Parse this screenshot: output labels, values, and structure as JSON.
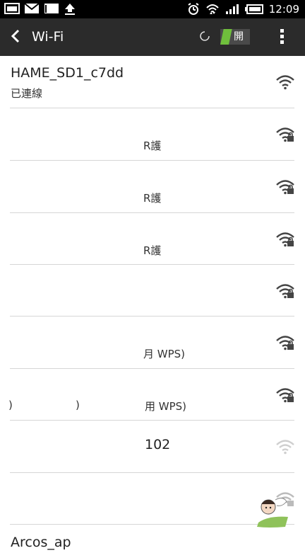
{
  "status_bar": {
    "time": "12:09",
    "icons": [
      "gallery-icon",
      "mail-icon",
      "gmail-icon",
      "upload-icon",
      "alarm-icon",
      "wifi-status-icon",
      "signal-icon",
      "battery-icon"
    ]
  },
  "action_bar": {
    "title": "Wi-Fi",
    "toggle_label": "開"
  },
  "networks": [
    {
      "ssid": "HAME_SD1_c7dd",
      "subtitle": "已連線",
      "secured": false
    },
    {
      "ssid": "",
      "subtitle": "R護",
      "secured": true
    },
    {
      "ssid": "",
      "subtitle": "R護",
      "secured": true
    },
    {
      "ssid": "",
      "subtitle": "R護",
      "secured": true
    },
    {
      "ssid": "",
      "subtitle": "",
      "secured": true
    },
    {
      "ssid": "",
      "subtitle": "月 WPS)",
      "secured": true
    },
    {
      "ssid": "",
      "subtitle": "用 WPS)",
      "secured": true,
      "fragments": [
        ")",
        ")"
      ]
    },
    {
      "ssid": "",
      "subtitle": "102",
      "secured": false,
      "weak": true
    },
    {
      "ssid": "",
      "subtitle": "",
      "secured": true
    },
    {
      "ssid": "Arcos_ap",
      "subtitle": "",
      "secured": false
    }
  ]
}
